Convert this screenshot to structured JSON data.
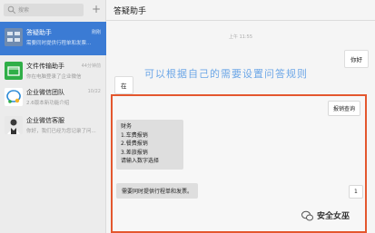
{
  "search": {
    "placeholder": "搜索"
  },
  "sidebar": {
    "add_label": "+",
    "conversations": [
      {
        "name": "答疑助手",
        "preview": "需要同时提供行程单和发票...",
        "time": "刚刚",
        "active": true,
        "avatar_text": "答疑助手",
        "avatar_color": "#6f8bb0"
      },
      {
        "name": "文件传输助手",
        "preview": "你在电脑登录了企业微信",
        "time": "44分钟前",
        "active": false,
        "avatar_text": "",
        "avatar_color": "#2fae47"
      },
      {
        "name": "企业微信团队",
        "preview": "2.6版本新功能介绍",
        "time": "10/22",
        "active": false,
        "avatar_text": "",
        "avatar_color": "#ffffff"
      },
      {
        "name": "企业微信客服",
        "preview": "你好，我们已经为您记录了问...",
        "time": "",
        "active": false,
        "avatar_text": "",
        "avatar_color": "#e8e8e8"
      }
    ]
  },
  "chat": {
    "title": "答疑助手",
    "timestamp": "上午 11:55",
    "messages": {
      "out_hello": "你好",
      "in_zai": "在",
      "overlay": "可以根据自己的需要设置问答规则",
      "out_query": "报销查询",
      "menu": [
        "财务",
        "1.车费报销",
        "2.餐费报销",
        "3.差旅报销",
        "请输入数字选择"
      ],
      "out_choice": "1",
      "reply": "需要同时提供行程单和发票。"
    }
  },
  "watermark": {
    "text": "安全女巫"
  },
  "colors": {
    "active": "#3b7bd4",
    "highlight_box": "#e4572e",
    "overlay_text": "#6da7e7"
  }
}
